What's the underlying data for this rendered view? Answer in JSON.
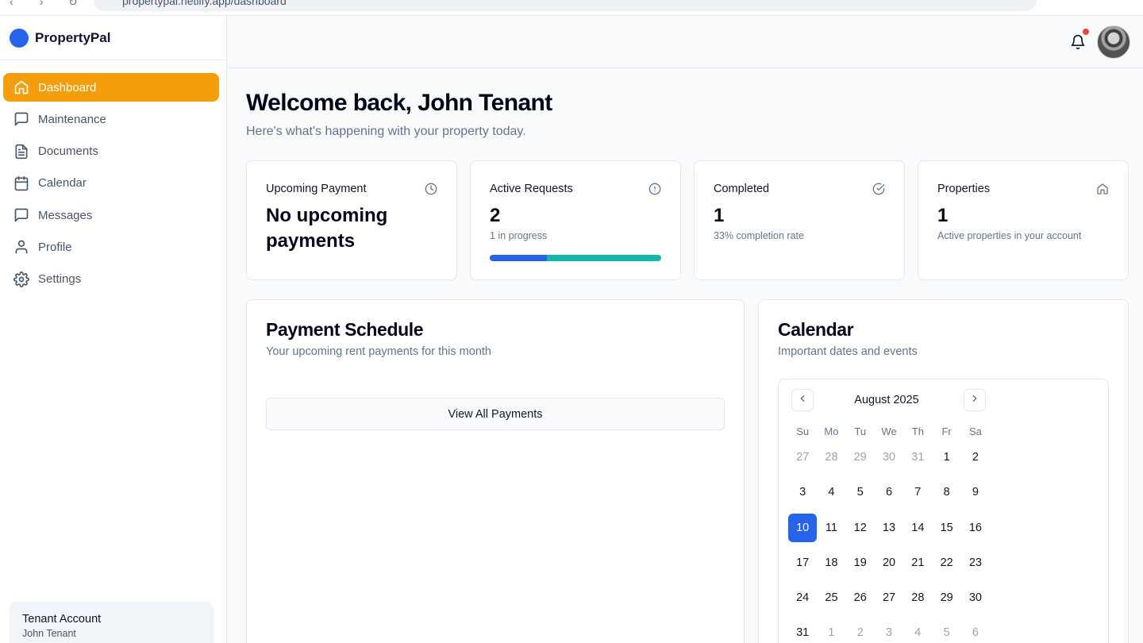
{
  "browser": {
    "url": "propertypal.netlify.app/dashboard"
  },
  "brand": {
    "name": "PropertyPal"
  },
  "sidebar": {
    "items": [
      {
        "label": "Dashboard",
        "icon": "home-icon",
        "active": true
      },
      {
        "label": "Maintenance",
        "icon": "message-square-icon"
      },
      {
        "label": "Documents",
        "icon": "file-text-icon"
      },
      {
        "label": "Calendar",
        "icon": "calendar-icon"
      },
      {
        "label": "Messages",
        "icon": "message-square-icon"
      },
      {
        "label": "Profile",
        "icon": "user-icon"
      },
      {
        "label": "Settings",
        "icon": "gear-icon"
      }
    ],
    "account": {
      "title": "Tenant Account",
      "name": "John Tenant"
    }
  },
  "header": {
    "notifications": "bell-icon",
    "has_unread": true
  },
  "main": {
    "title": "Welcome back, John Tenant",
    "subtitle": "Here's what's happening with your property today.",
    "stats": [
      {
        "label": "Upcoming Payment",
        "value": "No upcoming payments",
        "sub": "",
        "icon": "clock-icon"
      },
      {
        "label": "Active Requests",
        "value": "2",
        "sub": "1 in progress",
        "icon": "alert-circle-icon",
        "progress": {
          "in_progress": 1,
          "total": 3
        }
      },
      {
        "label": "Completed",
        "value": "1",
        "sub": "33% completion rate",
        "icon": "check-circle-icon"
      },
      {
        "label": "Properties",
        "value": "1",
        "sub": "Active properties in your account",
        "icon": "home-icon"
      }
    ],
    "payments": {
      "title": "Payment Schedule",
      "subtitle": "Your upcoming rent payments for this month",
      "button": "View All Payments"
    },
    "calendar": {
      "title": "Calendar",
      "subtitle": "Important dates and events",
      "month": "August 2025",
      "weekdays": [
        "Su",
        "Mo",
        "Tu",
        "We",
        "Th",
        "Fr",
        "Sa"
      ],
      "days": [
        [
          "27",
          "28",
          "29",
          "30",
          "31",
          "1",
          "2"
        ],
        [
          "3",
          "4",
          "5",
          "6",
          "7",
          "8",
          "9"
        ],
        [
          "10",
          "11",
          "12",
          "13",
          "14",
          "15",
          "16"
        ],
        [
          "17",
          "18",
          "19",
          "20",
          "21",
          "22",
          "23"
        ],
        [
          "24",
          "25",
          "26",
          "27",
          "28",
          "29",
          "30"
        ],
        [
          "31",
          "1",
          "2",
          "3",
          "4",
          "5",
          "6"
        ]
      ],
      "selected": "10",
      "colors": {
        "selected": "#2563eb"
      }
    }
  },
  "colors": {
    "accent": "#f59e0b",
    "primary": "#2563eb",
    "teal": "#14b8a6",
    "alert": "#ef4444"
  }
}
